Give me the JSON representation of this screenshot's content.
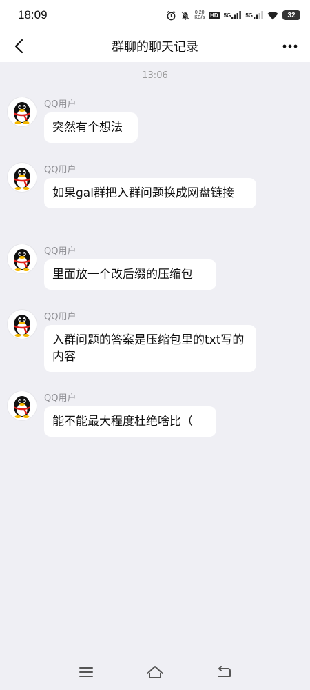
{
  "status_bar": {
    "time": "18:09",
    "net_speed_value": "0.20",
    "net_speed_unit": "KB/s",
    "hd_label": "HD",
    "sim1_label": "5G",
    "sim2_label": "5G",
    "battery_level": "32"
  },
  "header": {
    "title": "群聊的聊天记录"
  },
  "chat": {
    "timestamp": "13:06",
    "messages": [
      {
        "sender": "QQ用户",
        "text": "突然有个想法"
      },
      {
        "sender": "QQ用户",
        "text": "如果gal群把入群问题换成网盘链接"
      },
      {
        "sender": "QQ用户",
        "text": "里面放一个改后缀的压缩包"
      },
      {
        "sender": "QQ用户",
        "text": "入群问题的答案是压缩包里的txt写的内容"
      },
      {
        "sender": "QQ用户",
        "text": "能不能最大程度杜绝啥比（"
      }
    ]
  },
  "icons": {
    "back": "chevron-left-icon",
    "more": "more-dots-icon",
    "avatar": "qq-penguin-icon",
    "nav_menu": "menu-icon",
    "nav_home": "home-icon",
    "nav_back": "back-arrow-icon"
  },
  "colors": {
    "background": "#efeff4",
    "bubble": "#ffffff",
    "penguin_scarf": "#e0201b",
    "penguin_beak": "#f5b800"
  }
}
